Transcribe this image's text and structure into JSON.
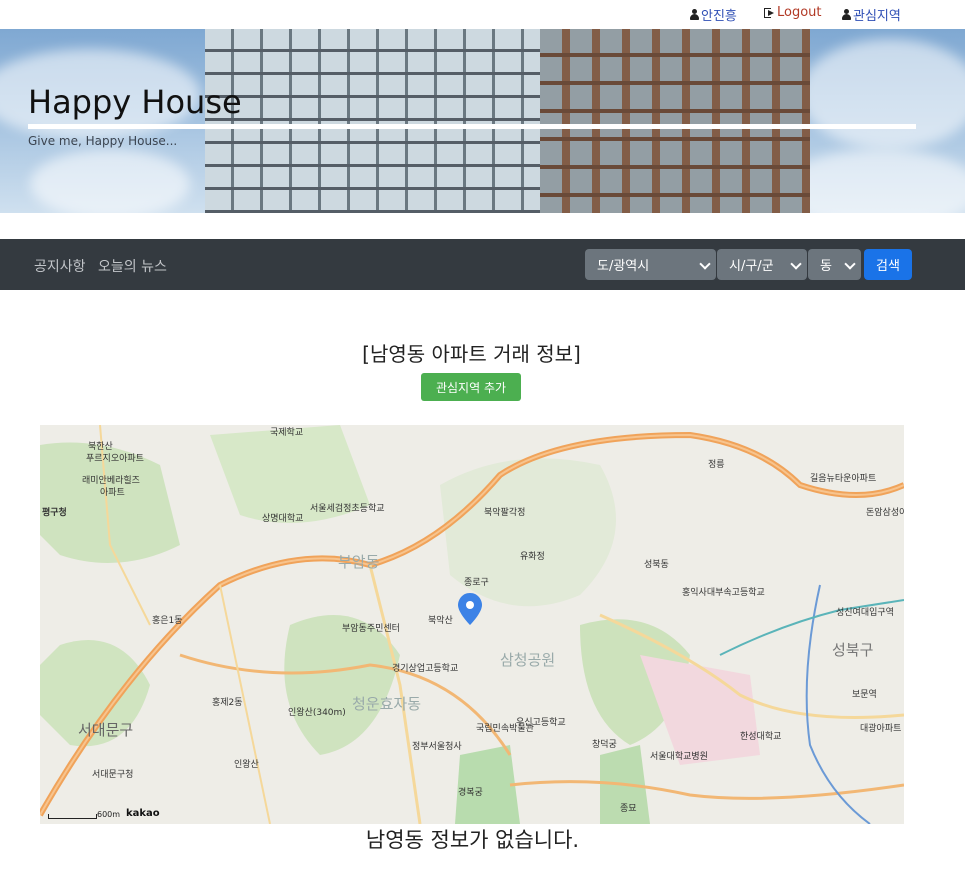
{
  "top_links": {
    "user": "안진흥",
    "logout": "Logout",
    "interest": "관심지역"
  },
  "hero": {
    "title": "Happy House",
    "subtitle": "Give me, Happy House..."
  },
  "nav": {
    "notice": "공지사항",
    "news": "오늘의 뉴스",
    "select_province": "도/광역시",
    "select_city": "시/구/군",
    "select_dong": "동",
    "search_button": "검색"
  },
  "main": {
    "heading": "[남영동 아파트 거래 정보]",
    "add_interest_button": "관심지역 추가",
    "no_info_message": "남영동 정보가 없습니다."
  },
  "map": {
    "scale_label": "600m",
    "logo": "kakao",
    "labels": [
      "북한산",
      "푸르지오아파트",
      "래미안베라힐즈",
      "아파트",
      "평구청",
      "국제학교",
      "종로구",
      "북악산",
      "북악팔각정",
      "성북동",
      "부암동",
      "부암동주민센터",
      "서울세검정초등학교",
      "상명대학교",
      "서대문구",
      "서대문구청",
      "청운효자동",
      "경기상업고등학교",
      "삼청공원",
      "정부서울청사",
      "경복궁",
      "국립민속박물관",
      "유화정",
      "성북구",
      "한성대학교",
      "성신여대입구역",
      "정릉",
      "보문역",
      "서울대학교병원",
      "종묘",
      "인왕산",
      "홍제2동",
      "홍은1동",
      "인왕산(340m)",
      "창덕궁",
      "홍익사대부속고등학교",
      "우신고등학교",
      "대광아파트",
      "돈암삼성아파트",
      "길음뉴타운아파트"
    ]
  },
  "colors": {
    "nav_bg": "#343a40",
    "select_bg": "#6c757d",
    "search_button": "#1a73e8",
    "add_button": "#4caf50",
    "link_blue": "#2f4fb5",
    "link_red": "#b23a26"
  }
}
